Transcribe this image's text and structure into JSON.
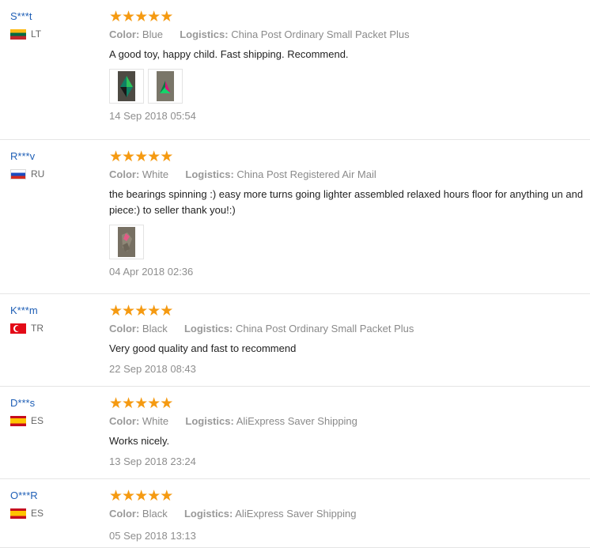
{
  "reviews": [
    {
      "user": "S***t",
      "country": "LT",
      "rating_stars": 5,
      "color_label": "Color:",
      "color_value": "Blue",
      "logistics_label": "Logistics:",
      "logistics_value": "China Post Ordinary Small Packet Plus",
      "feedback": "A good toy, happy child. Fast shipping. Recommend.",
      "date": "14 Sep 2018 05:54"
    },
    {
      "user": "R***v",
      "country": "RU",
      "rating_stars": 5,
      "color_label": "Color:",
      "color_value": "White",
      "logistics_label": "Logistics:",
      "logistics_value": "China Post Registered Air Mail",
      "feedback": "the bearings spinning :) easy more turns going lighter assembled relaxed hours floor for anything un and piece:) to seller thank you!:)",
      "date": "04 Apr 2018 02:36"
    },
    {
      "user": "K***m",
      "country": "TR",
      "rating_stars": 5,
      "color_label": "Color:",
      "color_value": "Black",
      "logistics_label": "Logistics:",
      "logistics_value": "China Post Ordinary Small Packet Plus",
      "feedback": "Very good quality and fast to recommend",
      "date": "22 Sep 2018 08:43"
    },
    {
      "user": "D***s",
      "country": "ES",
      "rating_stars": 5,
      "color_label": "Color:",
      "color_value": "White",
      "logistics_label": "Logistics:",
      "logistics_value": "AliExpress Saver Shipping",
      "feedback": "Works nicely.",
      "date": "13 Sep 2018 23:24"
    },
    {
      "user": "O***R",
      "country": "ES",
      "rating_stars": 5,
      "color_label": "Color:",
      "color_value": "Black",
      "logistics_label": "Logistics:",
      "logistics_value": "AliExpress Saver Shipping",
      "date": "05 Sep 2018 13:13"
    }
  ],
  "colors": {
    "username": "#1f5fb6",
    "star": "#f59a11",
    "meta": "#8a8a8a",
    "text": "#222222",
    "divider": "#e5e5e5"
  }
}
